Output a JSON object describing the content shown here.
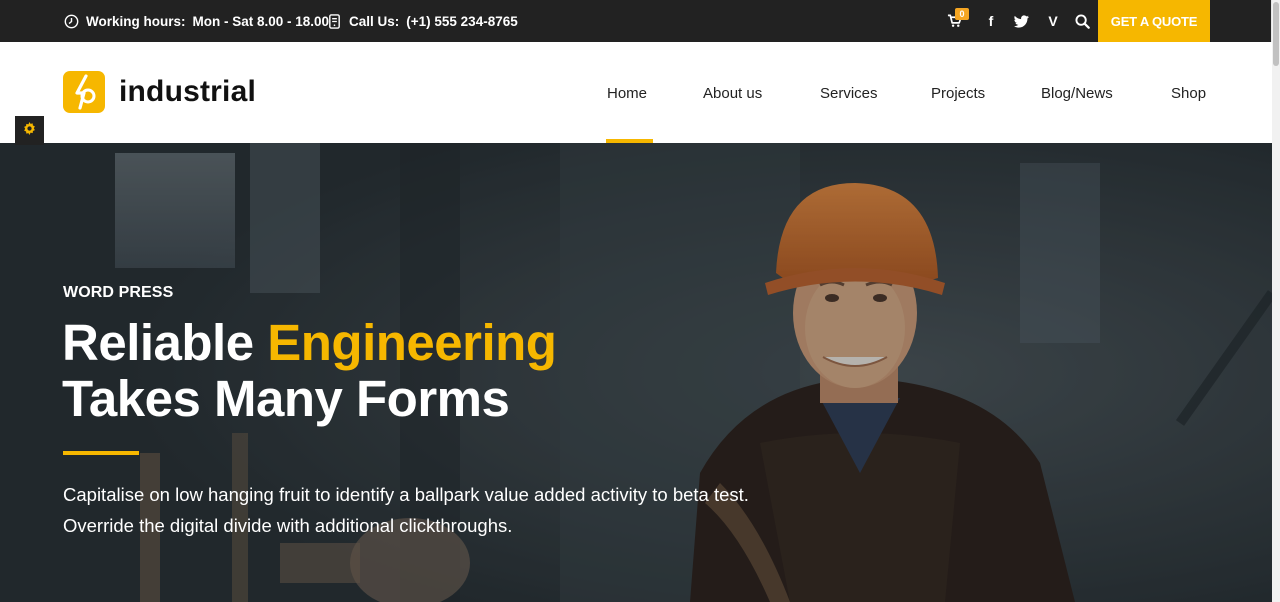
{
  "topbar": {
    "working_hours_label": "Working hours:",
    "working_hours_value": "Mon - Sat 8.00 - 18.00",
    "call_label": "Call Us:",
    "call_value": "(+1) 555 234-8765",
    "cart_count": "0",
    "social": {
      "facebook": "f",
      "twitter": "twitter-icon",
      "vine": "V"
    },
    "quote_button": "GET A QUOTE"
  },
  "header": {
    "logo_text": "industrial",
    "nav": [
      "Home",
      "About us",
      "Services",
      "Projects",
      "Blog/News",
      "Shop"
    ],
    "active_nav": "Home"
  },
  "hero": {
    "eyebrow": "WORD PRESS",
    "headline_part1": "Reliable ",
    "headline_highlight": "Engineering",
    "headline_line2": "Takes Many Forms",
    "paragraph_line1": "Capitalise on low hanging fruit to identify a ballpark value added activity to beta test.",
    "paragraph_line2": "Override the digital divide with additional clickthroughs."
  },
  "colors": {
    "accent": "#f6b700",
    "topbar_bg": "#222222",
    "text_dark": "#222222"
  }
}
